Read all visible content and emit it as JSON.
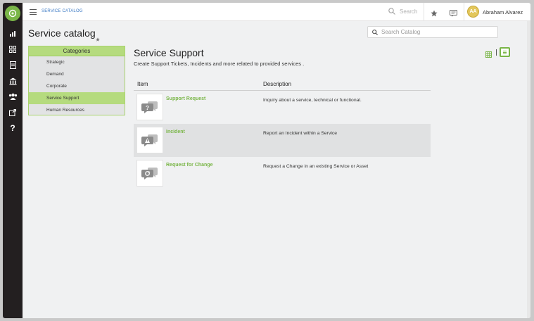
{
  "topbar": {
    "breadcrumb": "SERVICE CATALOG",
    "search_placeholder": "Search",
    "user_initials": "AA",
    "user_name": "Abraham Alvarez"
  },
  "page": {
    "title": "Service catalog",
    "catalog_search_placeholder": "Search Catalog"
  },
  "categories": {
    "header": "Categories",
    "items": [
      {
        "label": "Strategic"
      },
      {
        "label": "Demand"
      },
      {
        "label": "Corporate"
      },
      {
        "label": "Service Support"
      },
      {
        "label": "Human Resources"
      }
    ],
    "active": "Service Support"
  },
  "section": {
    "title": "Service Support",
    "description": "Create Support Tickets, Incidents and more related to provided services ."
  },
  "table": {
    "columns": [
      "Item",
      "Description"
    ],
    "rows": [
      {
        "name": "Support Request",
        "description": "Inquiry about a service, technical or functional.",
        "icon": "question-bubble-icon"
      },
      {
        "name": "Incident",
        "description": "Report an Incident within a Service",
        "icon": "warning-bubble-icon"
      },
      {
        "name": "Request for Change",
        "description": "Request a Change in an existing Service or Asset",
        "icon": "refresh-bubble-icon"
      }
    ]
  },
  "colors": {
    "accent": "#7ab648",
    "rail": "#231f20",
    "category_header": "#b5db7e",
    "breadcrumb": "#3b79c4"
  }
}
